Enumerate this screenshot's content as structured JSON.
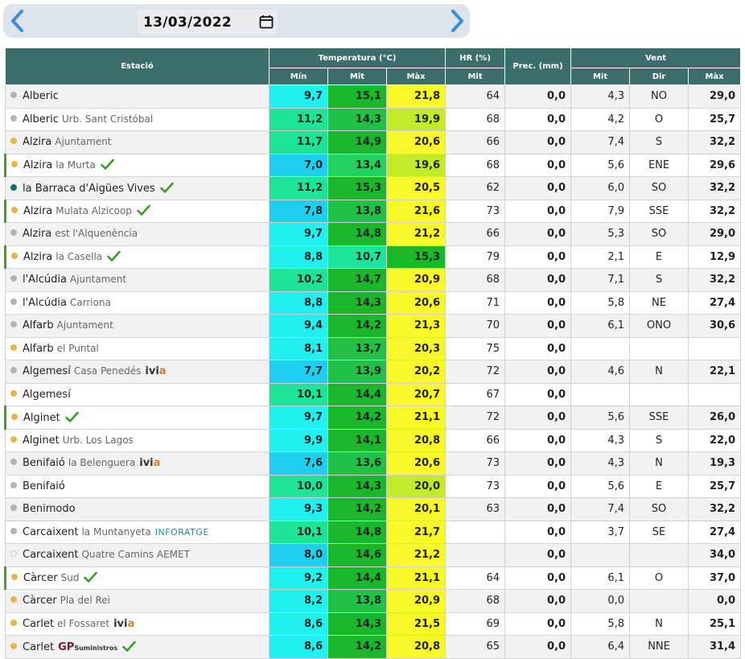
{
  "date": "13/03/2022",
  "headers": {
    "station": "Estació",
    "temperature": "Temperatura (°C)",
    "humidity": "HR (%)",
    "precipitation": "Prec. (mm)",
    "wind": "Vent",
    "t_min": "Mín",
    "t_mit": "Mit",
    "t_max": "Màx",
    "hr_mit": "Mit",
    "w_mit": "Mit",
    "w_dir": "Dir",
    "w_max": "Màx"
  },
  "colors": {
    "header_bg": "#3a6e6b",
    "accent_marked": "#4d9a2e",
    "dot_grey": "#b4b4b4",
    "dot_yellow": "#e8b54c",
    "dot_teal": "#1c6b63"
  },
  "rows": [
    {
      "name": "Alberic",
      "sub": "",
      "dot": "grey",
      "check": false,
      "logo": "",
      "marked": false,
      "tmin": "9,7",
      "tmit": "15,1",
      "tmax": "21,8",
      "hr": "64",
      "prec": "0,0",
      "wmit": "4,3",
      "wdir": "NO",
      "wmax": "29,0",
      "cmin": "#1ff1f1",
      "cmit": "#19b82c",
      "cmax": "#f9f92a"
    },
    {
      "name": "Alberic",
      "sub": "Urb. Sant Cristóbal",
      "dot": "grey",
      "check": false,
      "logo": "",
      "marked": false,
      "tmin": "11,2",
      "tmit": "14,3",
      "tmax": "19,9",
      "hr": "68",
      "prec": "0,0",
      "wmit": "4,2",
      "wdir": "O",
      "wmax": "25,7",
      "cmin": "#1de598",
      "cmit": "#20c145",
      "cmax": "#c2ec2a"
    },
    {
      "name": "Alzira",
      "sub": "Ajuntament",
      "dot": "yellow",
      "check": false,
      "logo": "",
      "marked": false,
      "tmin": "11,7",
      "tmit": "14,9",
      "tmax": "20,6",
      "hr": "66",
      "prec": "0,0",
      "wmit": "7,4",
      "wdir": "S",
      "wmax": "32,2",
      "cmin": "#1de598",
      "cmit": "#19b82c",
      "cmax": "#f9f92a"
    },
    {
      "name": "Alzira",
      "sub": "la Murta",
      "dot": "yellow",
      "check": true,
      "logo": "",
      "marked": true,
      "tmin": "7,0",
      "tmit": "13,4",
      "tmax": "19,6",
      "hr": "68",
      "prec": "0,0",
      "wmit": "5,6",
      "wdir": "ENE",
      "wmax": "29,6",
      "cmin": "#1ecfef",
      "cmit": "#20d35c",
      "cmax": "#c2ec2a"
    },
    {
      "name": "la Barraca d'Aigües Vives",
      "sub": "",
      "dot": "teal",
      "check": true,
      "logo": "",
      "marked": false,
      "tmin": "11,2",
      "tmit": "15,3",
      "tmax": "20,5",
      "hr": "62",
      "prec": "0,0",
      "wmit": "6,0",
      "wdir": "SO",
      "wmax": "32,2",
      "cmin": "#1de598",
      "cmit": "#19b82c",
      "cmax": "#f9f92a"
    },
    {
      "name": "Alzira",
      "sub": "Mulata Alzicoop",
      "dot": "yellow",
      "check": true,
      "logo": "",
      "marked": true,
      "tmin": "7,8",
      "tmit": "13,8",
      "tmax": "21,6",
      "hr": "73",
      "prec": "0,0",
      "wmit": "7,9",
      "wdir": "SSE",
      "wmax": "32,2",
      "cmin": "#1ecfef",
      "cmit": "#20c145",
      "cmax": "#f9f92a"
    },
    {
      "name": "Alzira",
      "sub": "est l'Alquenència",
      "dot": "grey",
      "check": false,
      "logo": "",
      "marked": false,
      "tmin": "9,7",
      "tmit": "14,8",
      "tmax": "21,2",
      "hr": "66",
      "prec": "0,0",
      "wmit": "5,3",
      "wdir": "SO",
      "wmax": "29,0",
      "cmin": "#1ff1f1",
      "cmit": "#19b82c",
      "cmax": "#f9f92a"
    },
    {
      "name": "Alzira",
      "sub": "la Casella",
      "dot": "yellow",
      "check": true,
      "logo": "",
      "marked": true,
      "tmin": "8,8",
      "tmit": "10,7",
      "tmax": "15,3",
      "hr": "79",
      "prec": "0,0",
      "wmit": "2,1",
      "wdir": "E",
      "wmax": "12,9",
      "cmin": "#1ff1f1",
      "cmit": "#1de598",
      "cmax": "#19b82c"
    },
    {
      "name": "l'Alcúdia",
      "sub": "Ajuntament",
      "dot": "grey",
      "check": false,
      "logo": "",
      "marked": false,
      "tmin": "10,2",
      "tmit": "14,7",
      "tmax": "20,9",
      "hr": "68",
      "prec": "0,0",
      "wmit": "7,1",
      "wdir": "S",
      "wmax": "32,2",
      "cmin": "#1de598",
      "cmit": "#19b82c",
      "cmax": "#f9f92a"
    },
    {
      "name": "l'Alcúdia",
      "sub": "Carriona",
      "dot": "grey",
      "check": false,
      "logo": "",
      "marked": false,
      "tmin": "8,8",
      "tmit": "14,3",
      "tmax": "20,6",
      "hr": "71",
      "prec": "0,0",
      "wmit": "5,8",
      "wdir": "NE",
      "wmax": "27,4",
      "cmin": "#1ff1f1",
      "cmit": "#19b82c",
      "cmax": "#f9f92a"
    },
    {
      "name": "Alfarb",
      "sub": "Ajuntament",
      "dot": "grey",
      "check": false,
      "logo": "",
      "marked": false,
      "tmin": "9,4",
      "tmit": "14,2",
      "tmax": "21,3",
      "hr": "70",
      "prec": "0,0",
      "wmit": "6,1",
      "wdir": "ONO",
      "wmax": "30,6",
      "cmin": "#1ff1f1",
      "cmit": "#19b82c",
      "cmax": "#f9f92a"
    },
    {
      "name": "Alfarb",
      "sub": "el Puntal",
      "dot": "yellow",
      "check": false,
      "logo": "",
      "marked": false,
      "tmin": "8,1",
      "tmit": "13,7",
      "tmax": "20,3",
      "hr": "75",
      "prec": "0,0",
      "wmit": "",
      "wdir": "",
      "wmax": "",
      "cmin": "#1ff1f1",
      "cmit": "#20c145",
      "cmax": "#f9f92a"
    },
    {
      "name": "Algemesí",
      "sub": "Casa Penedés",
      "dot": "grey",
      "check": false,
      "logo": "ivia",
      "marked": false,
      "tmin": "7,7",
      "tmit": "13,9",
      "tmax": "20,2",
      "hr": "72",
      "prec": "0,0",
      "wmit": "4,6",
      "wdir": "N",
      "wmax": "22,1",
      "cmin": "#1ecfef",
      "cmit": "#20c145",
      "cmax": "#f9f92a"
    },
    {
      "name": "Algemesí",
      "sub": "",
      "dot": "yellow",
      "check": false,
      "logo": "",
      "marked": false,
      "tmin": "10,1",
      "tmit": "14,4",
      "tmax": "20,7",
      "hr": "67",
      "prec": "0,0",
      "wmit": "",
      "wdir": "",
      "wmax": "",
      "cmin": "#1de598",
      "cmit": "#19b82c",
      "cmax": "#f9f92a"
    },
    {
      "name": "Alginet",
      "sub": "",
      "dot": "yellow",
      "check": true,
      "logo": "",
      "marked": true,
      "tmin": "9,7",
      "tmit": "14,2",
      "tmax": "21,1",
      "hr": "72",
      "prec": "0,0",
      "wmit": "5,6",
      "wdir": "SSE",
      "wmax": "26,0",
      "cmin": "#1ff1f1",
      "cmit": "#19b82c",
      "cmax": "#f9f92a"
    },
    {
      "name": "Alginet",
      "sub": "Urb. Los Lagos",
      "dot": "yellow",
      "check": false,
      "logo": "",
      "marked": false,
      "tmin": "9,9",
      "tmit": "14,1",
      "tmax": "20,8",
      "hr": "66",
      "prec": "0,0",
      "wmit": "4,3",
      "wdir": "S",
      "wmax": "22,0",
      "cmin": "#1ff1f1",
      "cmit": "#19b82c",
      "cmax": "#f9f92a"
    },
    {
      "name": "Benifaió",
      "sub": "la Belenguera",
      "dot": "grey",
      "check": false,
      "logo": "ivia",
      "marked": false,
      "tmin": "7,6",
      "tmit": "13,6",
      "tmax": "20,6",
      "hr": "73",
      "prec": "0,0",
      "wmit": "4,3",
      "wdir": "N",
      "wmax": "19,3",
      "cmin": "#1ecfef",
      "cmit": "#20c145",
      "cmax": "#f9f92a"
    },
    {
      "name": "Benifaió",
      "sub": "",
      "dot": "grey",
      "check": false,
      "logo": "",
      "marked": false,
      "tmin": "10,0",
      "tmit": "14,3",
      "tmax": "20,0",
      "hr": "73",
      "prec": "0,0",
      "wmit": "5,6",
      "wdir": "E",
      "wmax": "25,7",
      "cmin": "#1de598",
      "cmit": "#19b82c",
      "cmax": "#c2ec2a"
    },
    {
      "name": "Benimodo",
      "sub": "",
      "dot": "grey",
      "check": false,
      "logo": "",
      "marked": false,
      "tmin": "9,3",
      "tmit": "14,2",
      "tmax": "20,1",
      "hr": "63",
      "prec": "0,0",
      "wmit": "7,4",
      "wdir": "SO",
      "wmax": "32,2",
      "cmin": "#1ff1f1",
      "cmit": "#19b82c",
      "cmax": "#f9f92a"
    },
    {
      "name": "Carcaixent",
      "sub": "la Muntanyeta",
      "dot": "grey",
      "check": false,
      "logo": "inforatge",
      "marked": false,
      "tmin": "10,1",
      "tmit": "14,8",
      "tmax": "21,7",
      "hr": "",
      "prec": "0,0",
      "wmit": "3,7",
      "wdir": "SE",
      "wmax": "27,4",
      "cmin": "#1de598",
      "cmit": "#19b82c",
      "cmax": "#f9f92a"
    },
    {
      "name": "Carcaixent",
      "sub": "Quatre Camins AEMET",
      "dot": "hollow",
      "check": false,
      "logo": "",
      "marked": false,
      "tmin": "8,0",
      "tmit": "14,6",
      "tmax": "21,2",
      "hr": "",
      "prec": "0,0",
      "wmit": "",
      "wdir": "",
      "wmax": "34,0",
      "cmin": "#1ecfef",
      "cmit": "#19b82c",
      "cmax": "#f9f92a"
    },
    {
      "name": "Càrcer",
      "sub": "Sud",
      "dot": "yellow",
      "check": true,
      "logo": "",
      "marked": true,
      "tmin": "9,2",
      "tmit": "14,4",
      "tmax": "21,1",
      "hr": "64",
      "prec": "0,0",
      "wmit": "6,1",
      "wdir": "O",
      "wmax": "37,0",
      "cmin": "#1ff1f1",
      "cmit": "#19b82c",
      "cmax": "#f9f92a"
    },
    {
      "name": "Càrcer",
      "sub": "Pla del Rei",
      "dot": "yellow",
      "check": false,
      "logo": "",
      "marked": false,
      "tmin": "8,2",
      "tmit": "13,8",
      "tmax": "20,9",
      "hr": "68",
      "prec": "0,0",
      "wmit": "0,0",
      "wdir": "",
      "wmax": "0,0",
      "cmin": "#1ff1f1",
      "cmit": "#20c145",
      "cmax": "#f9f92a"
    },
    {
      "name": "Carlet",
      "sub": "el Fossaret",
      "dot": "yellow",
      "check": false,
      "logo": "ivia",
      "marked": false,
      "tmin": "8,6",
      "tmit": "14,3",
      "tmax": "21,5",
      "hr": "69",
      "prec": "0,0",
      "wmit": "5,8",
      "wdir": "N",
      "wmax": "25,1",
      "cmin": "#1ff1f1",
      "cmit": "#19b82c",
      "cmax": "#f9f92a"
    },
    {
      "name": "Carlet",
      "sub": "",
      "dot": "yellow",
      "check": true,
      "logo": "gp",
      "marked": false,
      "tmin": "8,6",
      "tmit": "14,2",
      "tmax": "20,8",
      "hr": "65",
      "prec": "0,0",
      "wmit": "6,4",
      "wdir": "NNE",
      "wmax": "31,4",
      "cmin": "#1ff1f1",
      "cmit": "#19b82c",
      "cmax": "#f9f92a"
    }
  ],
  "logos": {
    "ivia": {
      "text": "ivi",
      "accent": "a"
    },
    "inforatge": {
      "text": "INFORATGE"
    },
    "gp": {
      "text": "GP",
      "small": "Suministros"
    }
  },
  "icons": {
    "prev": "chevron-left-icon",
    "next": "chevron-right-icon",
    "calendar": "calendar-icon",
    "check": "check-icon"
  }
}
